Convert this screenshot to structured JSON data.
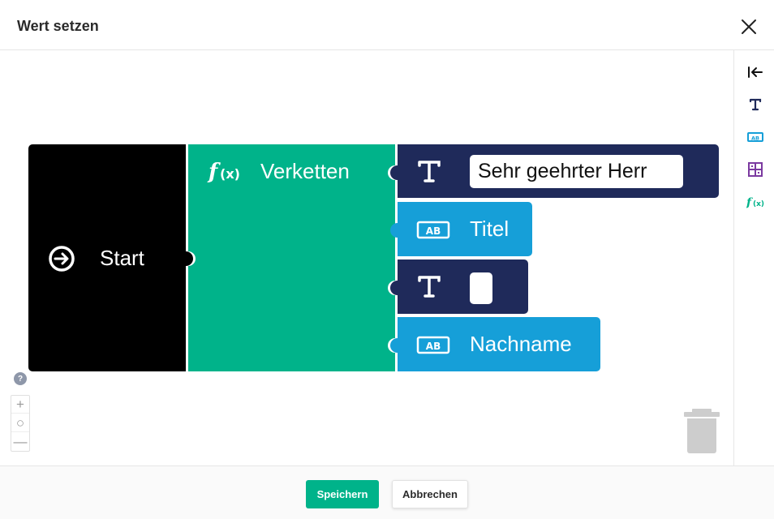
{
  "header": {
    "title": "Wert setzen"
  },
  "blocks": {
    "start": {
      "label": "Start"
    },
    "concat": {
      "label": "Verketten"
    },
    "text1": {
      "value": "Sehr geehrter Herr"
    },
    "field1": {
      "label": "Titel"
    },
    "text2": {
      "value": ""
    },
    "field2": {
      "label": "Nachname"
    }
  },
  "toolbox": {
    "items": [
      "collapse-icon",
      "text-icon",
      "field-icon",
      "grid-icon",
      "function-icon"
    ]
  },
  "zoom": {
    "plus": "+",
    "reset": "○",
    "minus": "—"
  },
  "help": {
    "label": "?"
  },
  "footer": {
    "save_label": "Speichern",
    "cancel_label": "Abbrechen"
  },
  "colors": {
    "start": "#000000",
    "concat": "#00b38a",
    "text_block": "#1f2a5a",
    "field_block": "#169fd8",
    "accent": "#00b38a"
  }
}
